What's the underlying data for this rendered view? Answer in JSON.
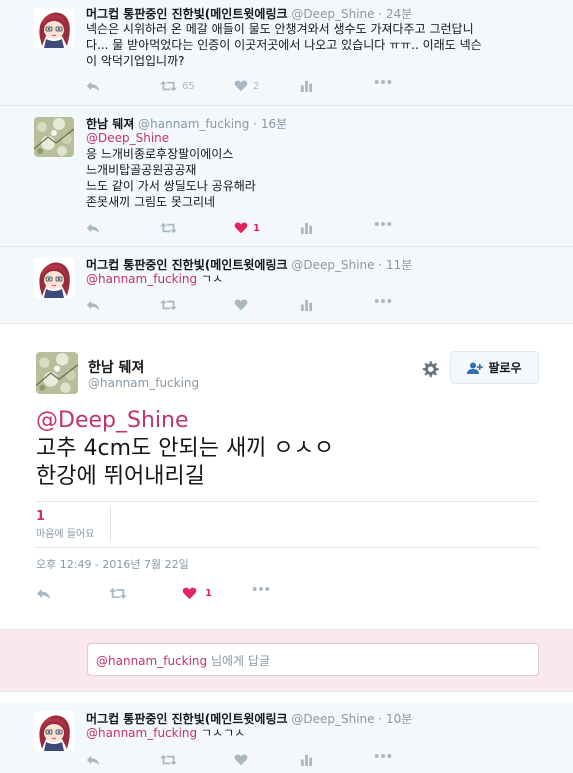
{
  "tweets": [
    {
      "name": "머그컵 통판중인 진한빛(메인트윗에링크",
      "handle": "@Deep_Shine",
      "time": "24분",
      "lines": [
        "넥슨은 시위하러 온 메갈 애들이 물도 안챙겨와서 생수도 가져다주고 그런답니",
        "다... 물 받아먹었다는 인증이 이곳저곳에서 나오고 있습니다 ㅠㅠ.. 이래도 넥슨",
        "이 악덕기업입니까?"
      ],
      "retweet_count": "65",
      "like_count": "2"
    },
    {
      "name": "한남 뒈져",
      "handle": "@hannam_fucking",
      "time": "16분",
      "mention": "@Deep_Shine",
      "lines": [
        "응 느개비종로후장팔이에이스",
        "느개비탑골공원공공재",
        "느도 같이 가서 쌍딜도나 공유해라",
        "존못새끼 그림도 못그리네"
      ],
      "like_count": "1"
    },
    {
      "name": "머그컵 통판중인 진한빛(메인트윗에링크",
      "handle": "@Deep_Shine",
      "time": "11분",
      "mention": "@hannam_fucking",
      "reply_text": "ㄱㅅ"
    },
    {
      "name": "머그컵 통판중인 진한빛(메인트윗에링크",
      "handle": "@Deep_Shine",
      "time": "10분",
      "mention": "@hannam_fucking",
      "reply_text": "ㄱㅅㄱㅅ"
    }
  ],
  "focused": {
    "name": "한남 뒈져",
    "handle": "@hannam_fucking",
    "follow_label": "팔로우",
    "mention": "@Deep_Shine",
    "line1": "고추 4cm도 안되는 새끼 ㅇㅅㅇ",
    "line2": "한강에 뛰어내리길",
    "like_count": "1",
    "like_label": "마음에 들어요",
    "timestamp": "오후 12:49 - 2016년 7월 22일",
    "action_like_count": "1"
  },
  "reply_box": {
    "mention": "@hannam_fucking",
    "suffix": " 님에게 답글"
  },
  "colors": {
    "accent": "#c0356e",
    "like_red": "#e0245e",
    "reply_bg": "#f9e8ee",
    "muted": "#8899a6",
    "icon": "#aab8c2"
  }
}
